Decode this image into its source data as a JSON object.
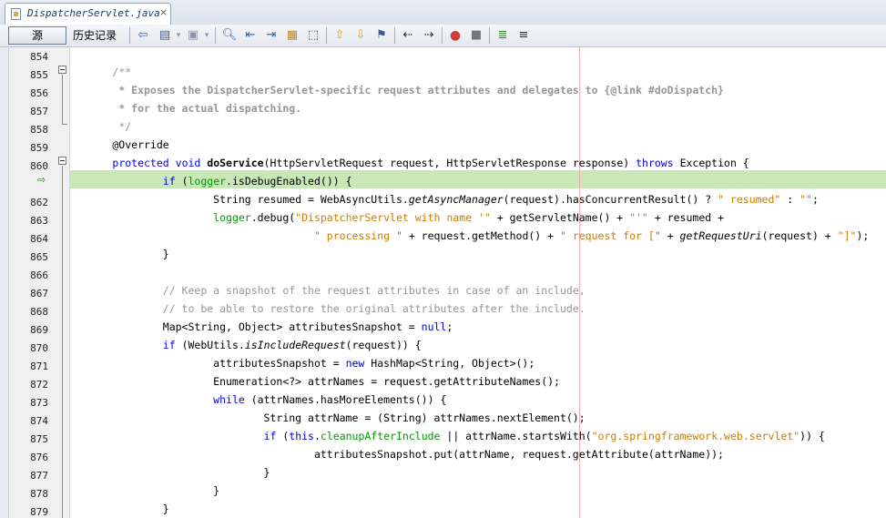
{
  "tab": {
    "title": "DispatcherServlet.java",
    "close": "×"
  },
  "toolbar": {
    "source_label": "源",
    "history_label": "历史记录",
    "icons": [
      "back-history-icon",
      "forward-history-icon",
      "last-edit-icon",
      "find-icon",
      "find-prev-icon",
      "find-next-icon",
      "toggle-highlight-icon",
      "rect-select-icon",
      "prev-bookmark-icon",
      "next-bookmark-icon",
      "toggle-bookmark-icon",
      "shift-left-icon",
      "shift-right-icon",
      "record-macro-icon",
      "stop-macro-icon",
      "comment-icon",
      "uncomment-icon"
    ]
  },
  "editor": {
    "line_numbers": [
      "854",
      "855",
      "856",
      "857",
      "858",
      "859",
      "860",
      "",
      "862",
      "863",
      "864",
      "865",
      "866",
      "867",
      "868",
      "869",
      "870",
      "871",
      "872",
      "873",
      "874",
      "875",
      "876",
      "877",
      "878",
      "879"
    ],
    "current_line_marker": "⇨",
    "current_line_highlight": "#c8e8b8",
    "right_margin_color": "#f0b0b0",
    "lines": [
      [],
      [
        {
          "t": "        "
        },
        {
          "c": "cmt",
          "t": "/**"
        }
      ],
      [
        {
          "t": "         "
        },
        {
          "c": "jdoc",
          "t": "* Exposes the DispatcherServlet-specific request attributes and delegates to {@link #doDispatch}"
        }
      ],
      [
        {
          "t": "         "
        },
        {
          "c": "jdoc",
          "t": "* for the actual dispatching."
        }
      ],
      [
        {
          "t": "         "
        },
        {
          "c": "cmt",
          "t": "*/"
        }
      ],
      [
        {
          "t": "        @Override"
        }
      ],
      [
        {
          "t": "        "
        },
        {
          "c": "kw",
          "t": "protected"
        },
        {
          "t": " "
        },
        {
          "c": "kw",
          "t": "void"
        },
        {
          "t": " "
        },
        {
          "c": "bold",
          "t": "doService"
        },
        {
          "t": "(HttpServletRequest request, HttpServletResponse response) "
        },
        {
          "c": "kw",
          "t": "throws"
        },
        {
          "t": " Exception {"
        }
      ],
      [
        {
          "t": "                "
        },
        {
          "c": "kw",
          "t": "if"
        },
        {
          "t": " ("
        },
        {
          "c": "fld",
          "t": "logger"
        },
        {
          "t": ".isDebugEnabled()) {"
        }
      ],
      [
        {
          "t": "                        String resumed = WebAsyncUtils."
        },
        {
          "c": "it",
          "t": "getAsyncManager"
        },
        {
          "t": "(request).hasConcurrentResult() ? "
        },
        {
          "c": "str",
          "t": "\" resumed\""
        },
        {
          "t": " : "
        },
        {
          "c": "str",
          "t": "\"\""
        },
        {
          "t": ";"
        }
      ],
      [
        {
          "t": "                        "
        },
        {
          "c": "fld",
          "t": "logger"
        },
        {
          "t": ".debug("
        },
        {
          "c": "str",
          "t": "\"DispatcherServlet with name '\""
        },
        {
          "t": " + getServletName() + "
        },
        {
          "c": "str",
          "t": "\"'\""
        },
        {
          "t": " + resumed +"
        }
      ],
      [
        {
          "t": "                                        "
        },
        {
          "c": "str",
          "t": "\" processing \""
        },
        {
          "t": " + request.getMethod() + "
        },
        {
          "c": "str",
          "t": "\" request for [\""
        },
        {
          "t": " + "
        },
        {
          "c": "it",
          "t": "getRequestUri"
        },
        {
          "t": "(request) + "
        },
        {
          "c": "str",
          "t": "\"]\""
        },
        {
          "t": ");"
        }
      ],
      [
        {
          "t": "                }"
        }
      ],
      [],
      [
        {
          "t": "                "
        },
        {
          "c": "cmt",
          "t": "// Keep a snapshot of the request attributes in case of an include,"
        }
      ],
      [
        {
          "t": "                "
        },
        {
          "c": "cmt",
          "t": "// to be able to restore the original attributes after the include."
        }
      ],
      [
        {
          "t": "                Map<String, Object> attributesSnapshot = "
        },
        {
          "c": "kw",
          "t": "null"
        },
        {
          "t": ";"
        }
      ],
      [
        {
          "t": "                "
        },
        {
          "c": "kw",
          "t": "if"
        },
        {
          "t": " (WebUtils."
        },
        {
          "c": "it",
          "t": "isIncludeRequest"
        },
        {
          "t": "(request)) {"
        }
      ],
      [
        {
          "t": "                        attributesSnapshot = "
        },
        {
          "c": "kw",
          "t": "new"
        },
        {
          "t": " HashMap<String, Object>();"
        }
      ],
      [
        {
          "t": "                        Enumeration<?> attrNames = request.getAttributeNames();"
        }
      ],
      [
        {
          "t": "                        "
        },
        {
          "c": "kw",
          "t": "while"
        },
        {
          "t": " (attrNames.hasMoreElements()) {"
        }
      ],
      [
        {
          "t": "                                String attrName = (String) attrNames.nextElement();"
        }
      ],
      [
        {
          "t": "                                "
        },
        {
          "c": "kw",
          "t": "if"
        },
        {
          "t": " ("
        },
        {
          "c": "kw",
          "t": "this"
        },
        {
          "t": "."
        },
        {
          "c": "fld",
          "t": "cleanupAfterInclude"
        },
        {
          "t": " || attrName.startsWith("
        },
        {
          "c": "str",
          "t": "\"org.springframework.web.servlet\""
        },
        {
          "t": ")) {"
        }
      ],
      [
        {
          "t": "                                        attributesSnapshot.put(attrName, request.getAttribute(attrName));"
        }
      ],
      [
        {
          "t": "                                }"
        }
      ],
      [
        {
          "t": "                        }"
        }
      ],
      [
        {
          "t": "                }"
        }
      ]
    ]
  }
}
